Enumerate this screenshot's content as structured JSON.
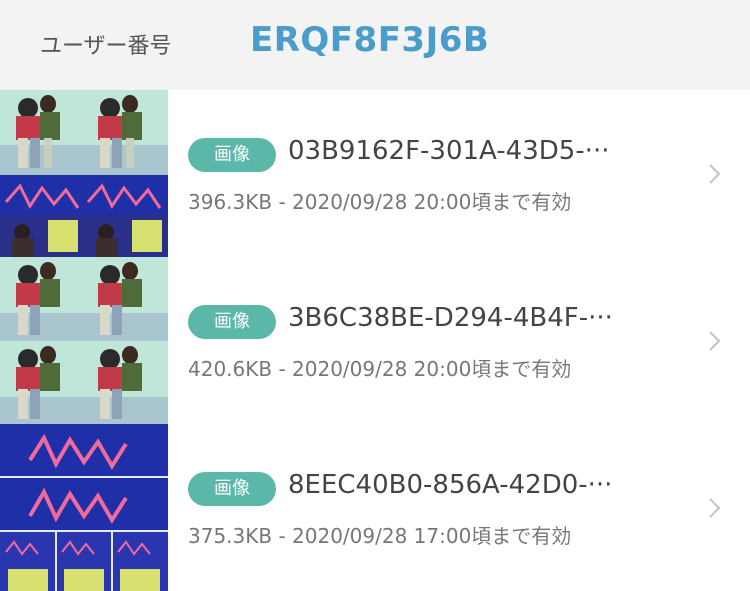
{
  "header": {
    "user_label": "ユーザー番号",
    "user_id": "ERQF8F3J6B"
  },
  "colors": {
    "accent": "#4a9cca",
    "badge": "#5bb8a8",
    "background": "#f3f3f3"
  },
  "files": [
    {
      "badge": "画像",
      "name": "03B9162F-301A-43D5-···",
      "meta": "396.3KB - 2020/09/28 20:00頃まで有効"
    },
    {
      "badge": "画像",
      "name": "3B6C38BE-D294-4B4F-···",
      "meta": "420.6KB - 2020/09/28 20:00頃まで有効"
    },
    {
      "badge": "画像",
      "name": "8EEC40B0-856A-42D0-···",
      "meta": "375.3KB - 2020/09/28 17:00頃まで有効"
    }
  ],
  "icons": {
    "row_chevron": "chevron-right-icon"
  }
}
